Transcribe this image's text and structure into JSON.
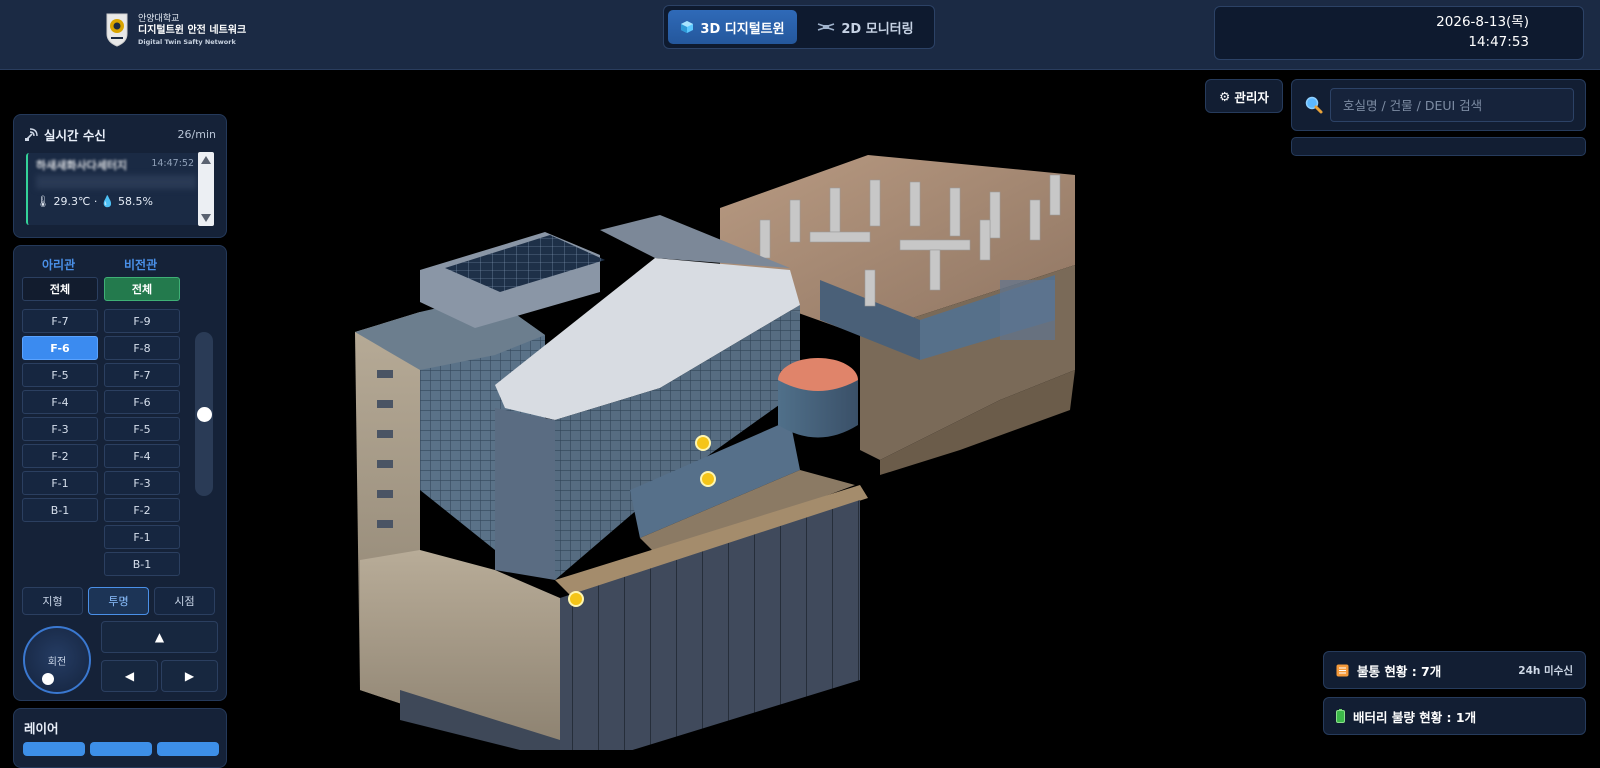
{
  "header": {
    "university": "안양대학교",
    "title": "디지털트윈 안전 네트워크",
    "subtitle": "Digital Twin Safty Network",
    "modes": [
      "3D 디지털트윈",
      "2D 모니터링"
    ],
    "date": "2026-8-13(목)",
    "time": "14:47:53"
  },
  "feed": {
    "title": "실시간 수신",
    "rate": "26/min",
    "item": {
      "name": "하새새화사다세터지",
      "time": "14:47:52",
      "temp": "29.3℃",
      "humidity": "58.5%"
    }
  },
  "floors": {
    "buildingA": {
      "name": "아리관",
      "all": "전체",
      "items": [
        "F-7",
        "F-6",
        "F-5",
        "F-4",
        "F-3",
        "F-2",
        "F-1",
        "B-1"
      ],
      "active": "F-6"
    },
    "buildingB": {
      "name": "비전관",
      "all": "전체",
      "items": [
        "F-9",
        "F-8",
        "F-7",
        "F-6",
        "F-5",
        "F-4",
        "F-3",
        "F-2",
        "F-1",
        "B-1"
      ]
    },
    "slider_level": 0.5
  },
  "view": {
    "terrain": "지형",
    "transparent": "투명",
    "viewpoint": "시점",
    "rotate": "회전"
  },
  "layers": {
    "title": "레이어"
  },
  "admin": {
    "label": "관리자"
  },
  "search": {
    "placeholder": "호실명 / 건물 / DEUI 검색"
  },
  "status": {
    "offline": "불통 현황 : 7개",
    "offline_tag": "24h 미수신",
    "battery": "배터리 불량 현황 : 1개"
  },
  "colors": {
    "accent": "#3b8bf0",
    "header_bg": "#1b2a44",
    "panel_bg": "#152238",
    "sensor": "#f5c518",
    "active_green": "#237a4d"
  }
}
